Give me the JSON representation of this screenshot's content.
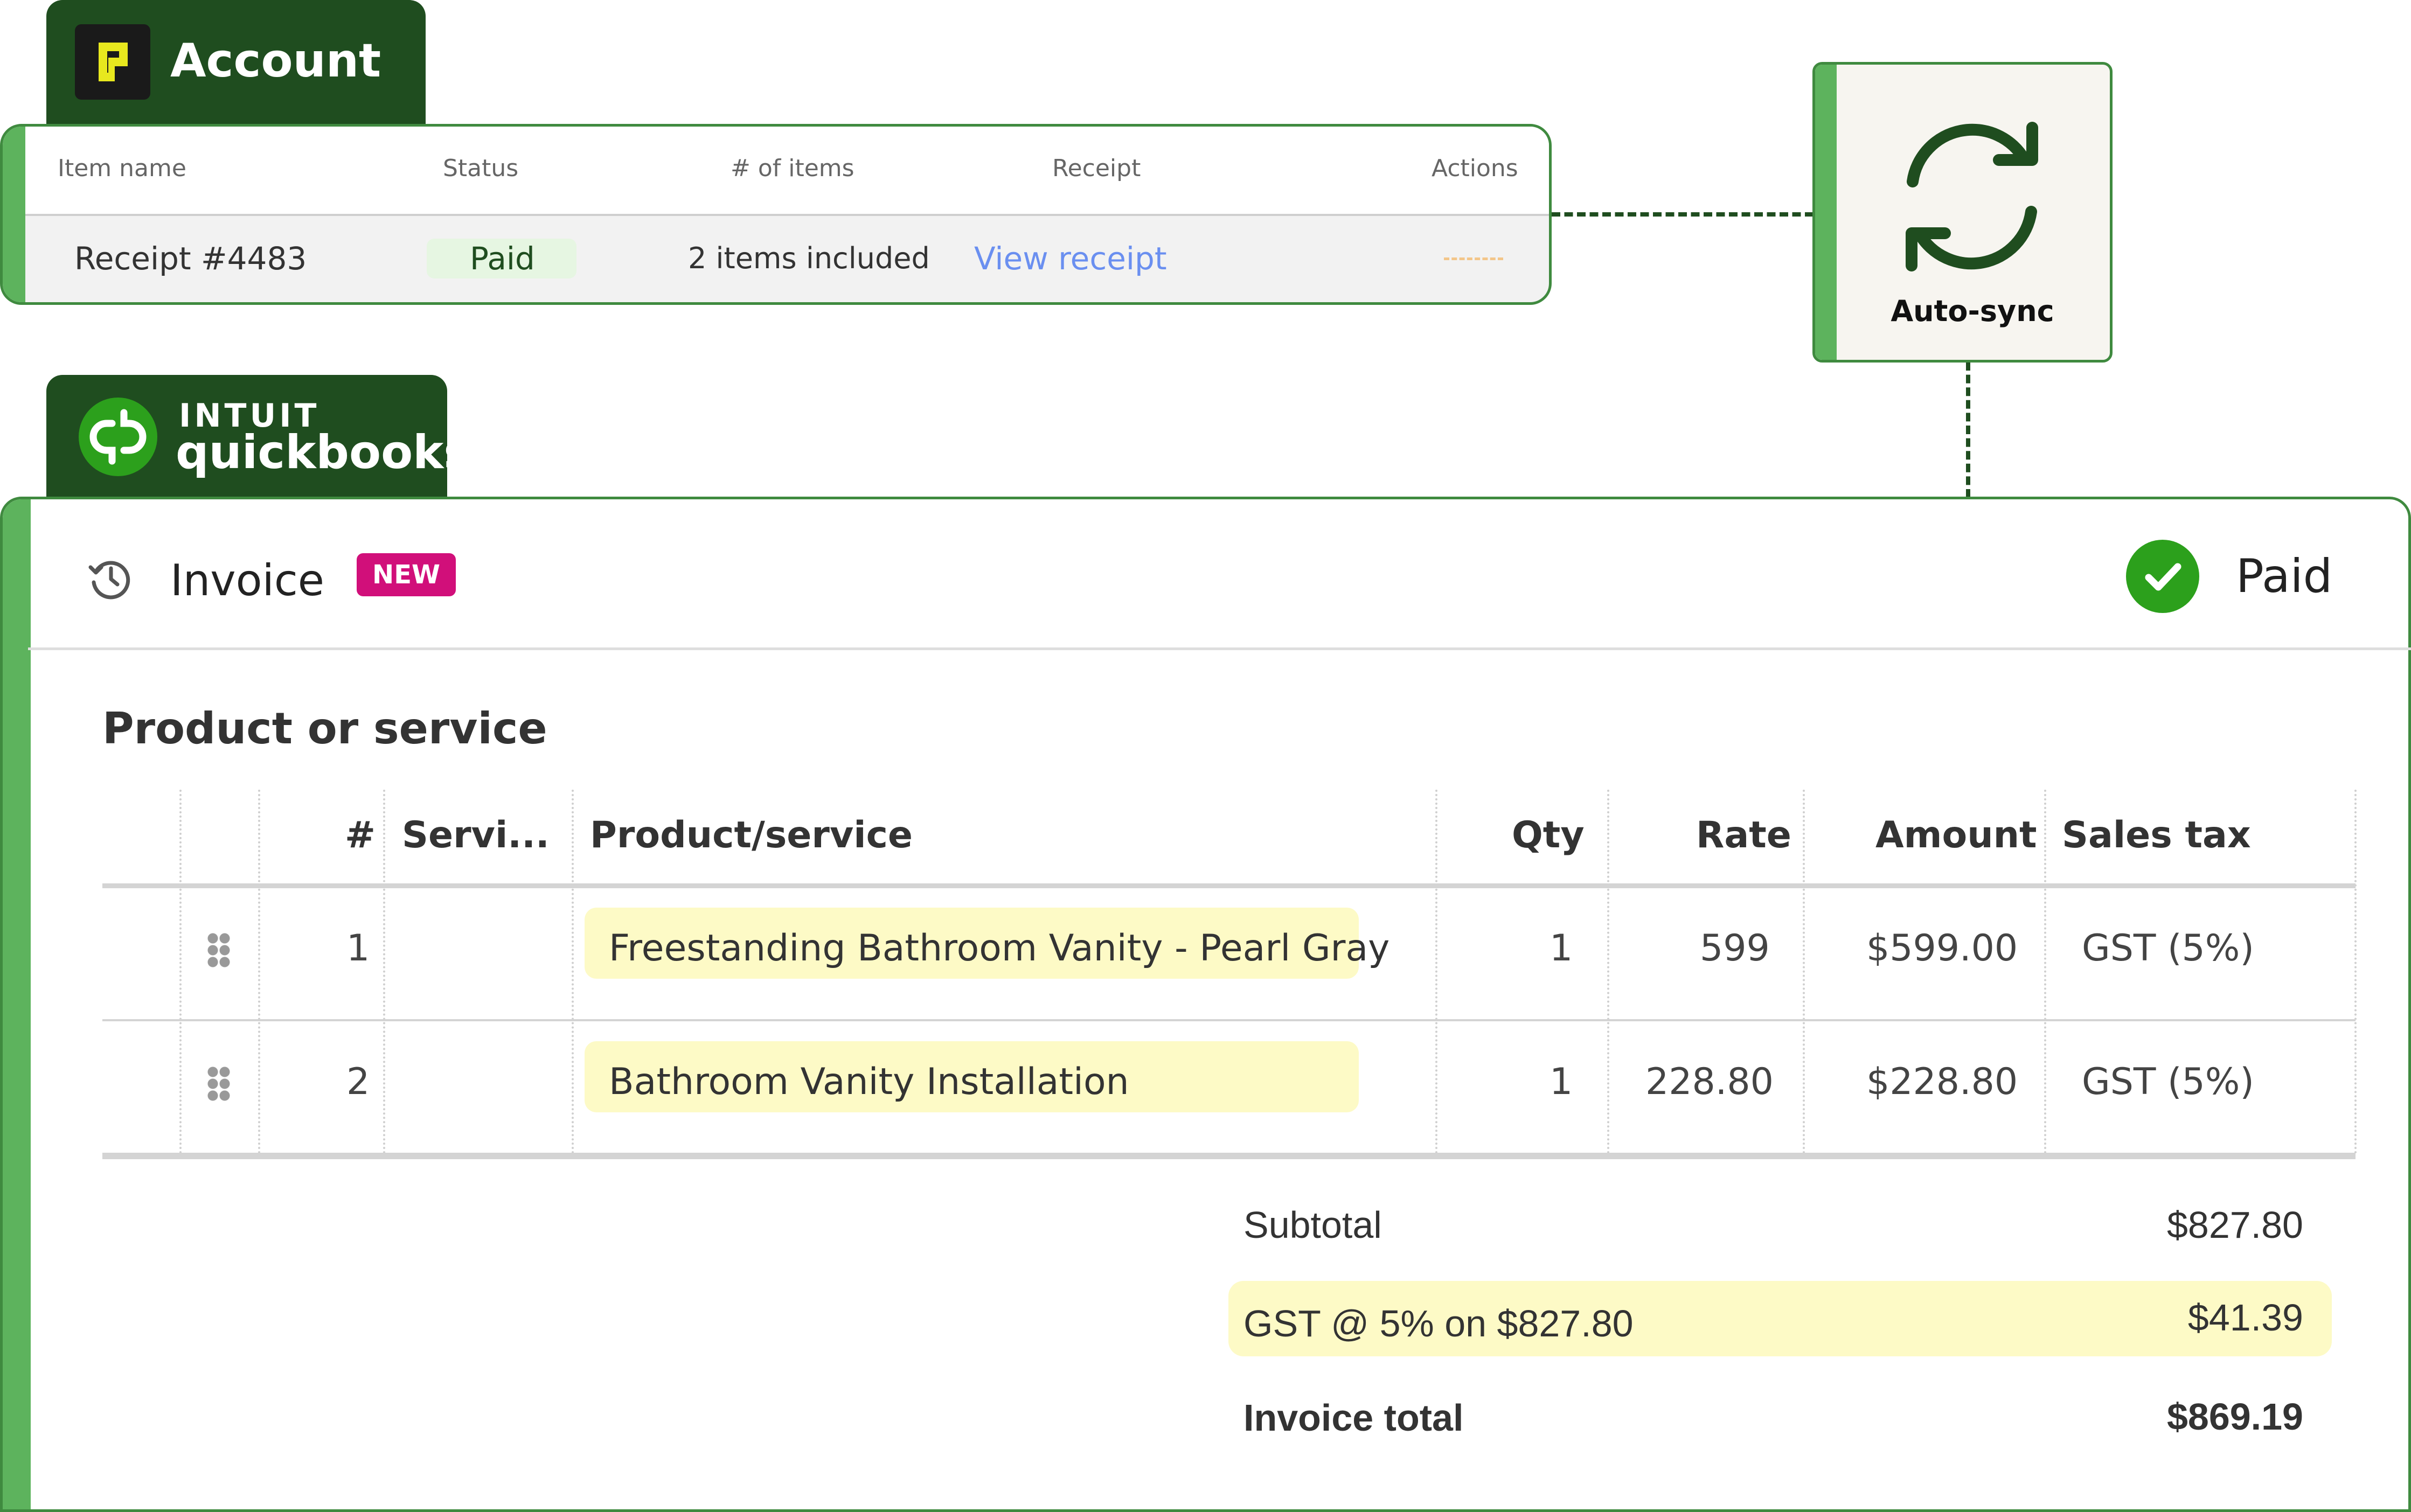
{
  "account": {
    "title": "Account",
    "columns": [
      "Item name",
      "Status",
      "# of items",
      "Receipt",
      "Actions"
    ],
    "row": {
      "item_name": "Receipt #4483",
      "status": "Paid",
      "items": "2 items included",
      "receipt_link": "View receipt"
    }
  },
  "sync": {
    "label": "Auto-sync"
  },
  "quickbooks": {
    "brand_top": "INTUIT",
    "brand_bottom": "quickbooks"
  },
  "invoice": {
    "title": "Invoice",
    "badge": "NEW",
    "status": "Paid",
    "section_title": "Product or service",
    "columns": {
      "number": "#",
      "service": "Servi...",
      "product": "Product/service",
      "qty": "Qty",
      "rate": "Rate",
      "amount": "Amount",
      "tax": "Sales tax"
    },
    "rows": [
      {
        "num": "1",
        "product": "Freestanding Bathroom Vanity - Pearl Gray",
        "qty": "1",
        "rate": "599",
        "amount": "$599.00",
        "tax": "GST (5%)"
      },
      {
        "num": "2",
        "product": "Bathroom Vanity Installation",
        "qty": "1",
        "rate": "228.80",
        "amount": "$228.80",
        "tax": "GST (5%)"
      }
    ],
    "summary": {
      "subtotal_label": "Subtotal",
      "subtotal": "$827.80",
      "gst_label": "GST @ 5% on $827.80",
      "gst": "$41.39",
      "total_label": "Invoice total",
      "total": "$869.19"
    }
  },
  "colors": {
    "brand_dark_green": "#1f4d1f",
    "accent_green": "#5db35d",
    "qb_green": "#2ca01c",
    "badge_magenta": "#d10f7a",
    "link_blue": "#6a8ff0",
    "highlight_yellow": "#fdfac6"
  },
  "icons": [
    "account-logo-icon",
    "sync-icon",
    "quickbooks-logo-icon",
    "history-icon",
    "check-circle-icon",
    "drag-handle-icon"
  ]
}
